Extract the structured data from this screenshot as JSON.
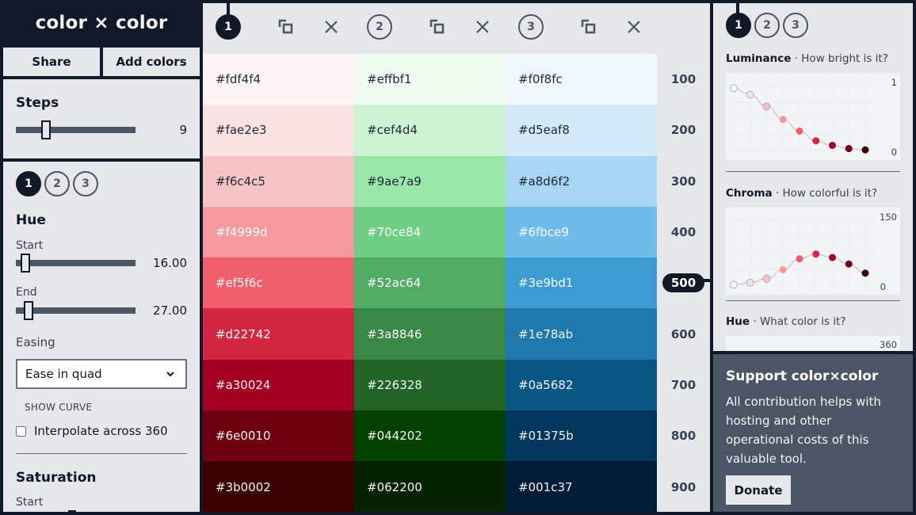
{
  "app": {
    "title": "color × color"
  },
  "toolbar": {
    "share_label": "Share",
    "add_colors_label": "Add colors"
  },
  "steps": {
    "label": "Steps",
    "value": "9",
    "min": 2,
    "max": 20,
    "current": 9
  },
  "settings_tabs": [
    "1",
    "2",
    "3"
  ],
  "hue": {
    "label": "Hue",
    "start_label": "Start",
    "start_value": "16.00",
    "start_fraction": 0.044,
    "end_label": "End",
    "end_value": "27.00",
    "end_fraction": 0.075,
    "easing_label": "Easing",
    "easing_value": "Ease in quad",
    "show_curve_label": "SHOW CURVE",
    "interpolate_label": "Interpolate across 360",
    "interpolate_checked": false
  },
  "saturation": {
    "label": "Saturation",
    "start_label": "Start"
  },
  "palettes": [
    {
      "number": "1",
      "active": true,
      "colors": [
        "#fdf4f4",
        "#fae2e3",
        "#f6c4c5",
        "#f4999d",
        "#ef5f6c",
        "#d22742",
        "#a30024",
        "#6e0010",
        "#3b0002"
      ]
    },
    {
      "number": "2",
      "active": false,
      "colors": [
        "#effbf1",
        "#cef4d4",
        "#9ae7a9",
        "#70ce84",
        "#52ac64",
        "#3a8846",
        "#226328",
        "#044202",
        "#062200"
      ]
    },
    {
      "number": "3",
      "active": false,
      "colors": [
        "#f0f8fc",
        "#d5eaf8",
        "#a8d6f2",
        "#6fbce9",
        "#3e9bd1",
        "#1e78ab",
        "#0a5682",
        "#01375b",
        "#001c37"
      ]
    }
  ],
  "scale": [
    "100",
    "200",
    "300",
    "400",
    "500",
    "600",
    "700",
    "800",
    "900"
  ],
  "active_scale": "500",
  "right_tabs": [
    "1",
    "2",
    "3"
  ],
  "luminance": {
    "name": "Luminance",
    "question": "· How bright is it?",
    "max_label": "1",
    "min_label": "0"
  },
  "chroma": {
    "name": "Chroma",
    "question": "· How colorful is it?",
    "max_label": "150",
    "min_label": "0"
  },
  "hue_chart": {
    "name": "Hue",
    "question": "· What color is it?",
    "max_label": "360"
  },
  "chart_data": [
    {
      "type": "scatter",
      "title": "Luminance",
      "x": [
        1,
        2,
        3,
        4,
        5,
        6,
        7,
        8,
        9
      ],
      "values": [
        0.96,
        0.86,
        0.68,
        0.48,
        0.3,
        0.15,
        0.08,
        0.03,
        0.01
      ],
      "ylim": [
        0,
        1
      ],
      "grid": true
    },
    {
      "type": "scatter",
      "title": "Chroma",
      "x": [
        1,
        2,
        3,
        4,
        5,
        6,
        7,
        8,
        9
      ],
      "values": [
        1,
        6,
        15,
        36,
        61,
        72,
        64,
        49,
        28
      ],
      "ylim": [
        0,
        150
      ],
      "grid": true
    }
  ],
  "support": {
    "title": "Support color×color",
    "body": "All contribution helps with hosting and other operational costs of this valuable tool.",
    "donate_label": "Donate"
  },
  "colors": {
    "dark": "#111827",
    "panel": "#e5e7eb",
    "slider": "#4b5563",
    "support_bg": "#4b5563"
  }
}
